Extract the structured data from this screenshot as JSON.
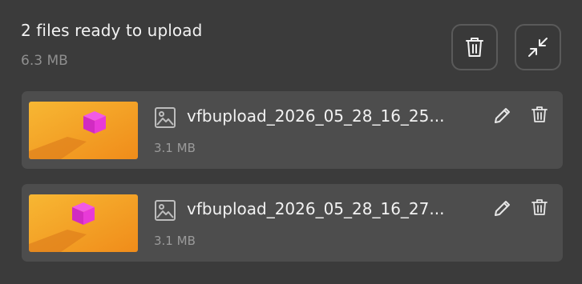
{
  "header": {
    "title": "2 files ready to upload",
    "total_size": "6.3 MB"
  },
  "actions": {
    "delete_all_icon": "trash-icon",
    "collapse_icon": "collapse-arrows-icon"
  },
  "files": [
    {
      "name": "vfbupload_2026_05_28_16_25...",
      "size": "3.1 MB",
      "type_icon": "image-icon",
      "edit_icon": "pencil-icon",
      "delete_icon": "trash-icon"
    },
    {
      "name": "vfbupload_2026_05_28_16_27...",
      "size": "3.1 MB",
      "type_icon": "image-icon",
      "edit_icon": "pencil-icon",
      "delete_icon": "trash-icon"
    }
  ],
  "colors": {
    "background": "#3b3b3b",
    "card": "#4d4d4d",
    "thumbnail_orange": "#f5a623",
    "thumbnail_cube": "#e83ad8"
  }
}
